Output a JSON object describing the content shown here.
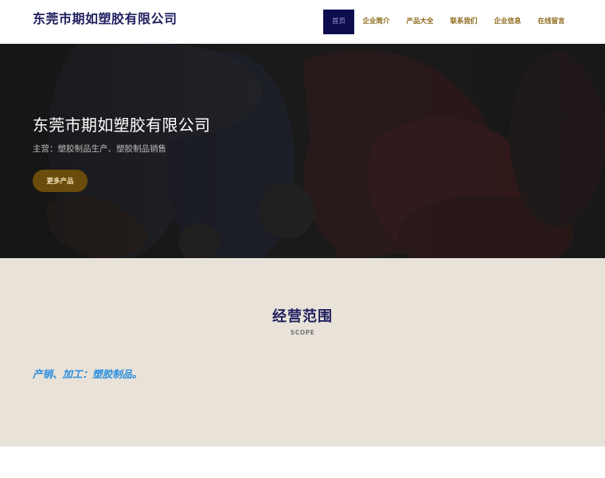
{
  "header": {
    "company_name": "东莞市期如塑胶有限公司",
    "nav": [
      {
        "label": "首页",
        "active": true
      },
      {
        "label": "企业简介",
        "active": false
      },
      {
        "label": "产品大全",
        "active": false
      },
      {
        "label": "联系我们",
        "active": false
      },
      {
        "label": "企业信息",
        "active": false
      },
      {
        "label": "在线留言",
        "active": false
      }
    ]
  },
  "hero": {
    "title": "东莞市期如塑胶有限公司",
    "subtitle": "主营：塑胶制品生产、塑胶制品销售",
    "button_label": "更多产品"
  },
  "scope": {
    "title": "经营范围",
    "subtitle": "SCOPE",
    "text": "产销、加工：塑胶制品。"
  },
  "colors": {
    "nav_active_bg": "#0d0d4e",
    "nav_text": "#8c6a1a",
    "button_bg": "#6b4c0c",
    "scope_bg": "#e8e2d8",
    "scope_text": "#2a8ee0",
    "title_color": "#1f1f5e"
  }
}
